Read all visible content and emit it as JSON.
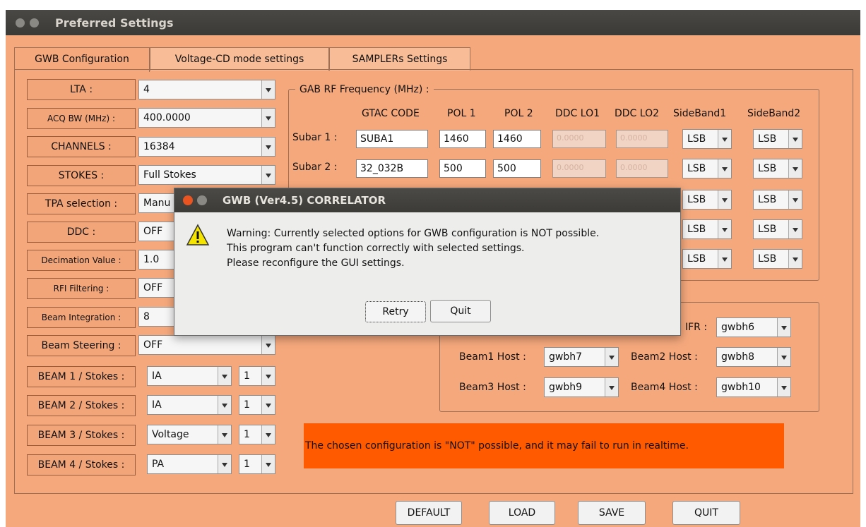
{
  "window": {
    "title": "Preferred Settings"
  },
  "tabs": [
    "GWB Configuration",
    "Voltage-CD mode settings",
    "SAMPLERs Settings"
  ],
  "left": {
    "lta": {
      "label": "LTA :",
      "value": "4"
    },
    "acq": {
      "label": "ACQ BW (MHz) :",
      "value": "400.0000"
    },
    "channels": {
      "label": "CHANNELS :",
      "value": "16384"
    },
    "stokes": {
      "label": "STOKES :",
      "value": "Full Stokes"
    },
    "tpa": {
      "label": "TPA selection :",
      "value": "Manu"
    },
    "ddc": {
      "label": "DDC :",
      "value": "OFF"
    },
    "decimation": {
      "label": "Decimation Value :",
      "value": "1.0"
    },
    "rfi": {
      "label": "RFI Filtering :",
      "value": "OFF"
    },
    "beamint": {
      "label": "Beam Integration :",
      "value": "8"
    },
    "steering": {
      "label": "Beam Steering :",
      "value": "OFF"
    },
    "beams": [
      {
        "label": "BEAM 1 / Stokes :",
        "mode": "IA",
        "num": "1"
      },
      {
        "label": "BEAM 2 / Stokes :",
        "mode": "IA",
        "num": "1"
      },
      {
        "label": "BEAM 3 / Stokes :",
        "mode": "Voltage",
        "num": "1"
      },
      {
        "label": "BEAM 4 / Stokes :",
        "mode": "PA",
        "num": "1"
      }
    ]
  },
  "gab": {
    "legend": "GAB RF Frequency (MHz) :",
    "headers": [
      "GTAC CODE",
      "POL 1",
      "POL 2",
      "DDC LO1",
      "DDC LO2",
      "SideBand1",
      "SideBand2"
    ],
    "subar1": {
      "label": "Subar 1 :",
      "code": "SUBA1",
      "pol1": "1460",
      "pol2": "1460",
      "lo1": "0.0000",
      "lo2": "0.0000"
    },
    "subar2": {
      "label": "Subar 2 :",
      "code": "32_032B",
      "pol1": "500",
      "pol2": "500",
      "lo1": "0.0000",
      "lo2": "0.0000"
    },
    "sideband": "LSB"
  },
  "hosts": {
    "ifr_label": "IFR :",
    "ifr": "gwbh6",
    "b1_label": "Beam1 Host :",
    "b1": "gwbh7",
    "b2_label": "Beam2 Host :",
    "b2": "gwbh8",
    "b3_label": "Beam3 Host :",
    "b3": "gwbh9",
    "b4_label": "Beam4 Host :",
    "b4": "gwbh10"
  },
  "status_message": "The chosen configuration is \"NOT\" possible, and it may fail to run in realtime.",
  "bottom_buttons": [
    "DEFAULT",
    "LOAD",
    "SAVE",
    "QUIT"
  ],
  "dialog": {
    "title": "GWB (Ver4.5) CORRELATOR",
    "line1": "Warning: Currently selected options for GWB configuration is NOT possible.",
    "line2": "This program can't function correctly with selected settings.",
    "line3": "Please reconfigure the GUI settings.",
    "retry": "Retry",
    "quit": "Quit"
  },
  "colors": {
    "window_bg": "#f5a87c",
    "status_bg": "#ff5a00",
    "titlebar": "#3c3b37"
  }
}
